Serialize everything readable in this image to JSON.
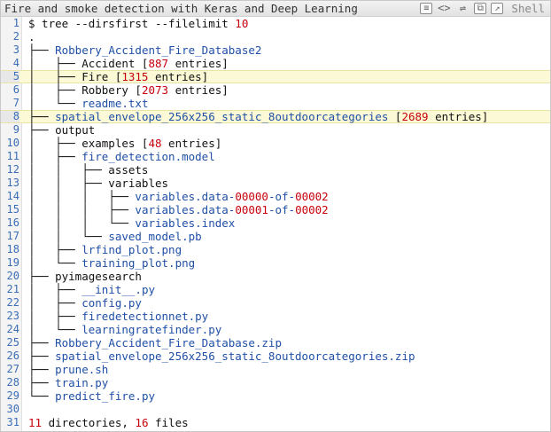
{
  "window": {
    "title": "Fire and smoke detection with Keras and Deep Learning",
    "toolbar": {
      "icons": [
        "code-icon",
        "embed-icon",
        "wrap-icon",
        "copy-icon",
        "popout-icon"
      ],
      "label": "Shell"
    }
  },
  "colors": {
    "default": "#111111",
    "file": "#1f4fa6",
    "num": "#c7000b",
    "highlight": "#fcfad6",
    "line_number": "#3b6db5"
  },
  "lines": [
    {
      "n": "1",
      "hl": false,
      "segs": [
        {
          "t": "$ tree --dirsfirst --filelimit ",
          "c": "default"
        },
        {
          "t": "10",
          "c": "num"
        }
      ]
    },
    {
      "n": "2",
      "hl": false,
      "segs": [
        {
          "t": ".",
          "c": "default"
        }
      ]
    },
    {
      "n": "3",
      "hl": false,
      "segs": [
        {
          "t": "├── ",
          "c": "default"
        },
        {
          "t": "Robbery_Accident_Fire_Database2",
          "c": "file"
        }
      ]
    },
    {
      "n": "4",
      "hl": false,
      "segs": [
        {
          "t": "│   ├── Accident [",
          "c": "default"
        },
        {
          "t": "887",
          "c": "num"
        },
        {
          "t": " entries]",
          "c": "default"
        }
      ]
    },
    {
      "n": "5",
      "hl": true,
      "segs": [
        {
          "t": "│   ├── Fire [",
          "c": "default"
        },
        {
          "t": "1315",
          "c": "num"
        },
        {
          "t": " entries]",
          "c": "default"
        }
      ]
    },
    {
      "n": "6",
      "hl": false,
      "segs": [
        {
          "t": "│   ├── Robbery [",
          "c": "default"
        },
        {
          "t": "2073",
          "c": "num"
        },
        {
          "t": " entries]",
          "c": "default"
        }
      ]
    },
    {
      "n": "7",
      "hl": false,
      "segs": [
        {
          "t": "│   └── ",
          "c": "default"
        },
        {
          "t": "readme.txt",
          "c": "file"
        }
      ]
    },
    {
      "n": "8",
      "hl": true,
      "segs": [
        {
          "t": "├── ",
          "c": "default"
        },
        {
          "t": "spatial_envelope_256x256_static_8outdoorcategories",
          "c": "file"
        },
        {
          "t": " [",
          "c": "default"
        },
        {
          "t": "2689",
          "c": "num"
        },
        {
          "t": " entries]",
          "c": "default"
        }
      ]
    },
    {
      "n": "9",
      "hl": false,
      "segs": [
        {
          "t": "├── output",
          "c": "default"
        }
      ]
    },
    {
      "n": "10",
      "hl": false,
      "segs": [
        {
          "t": "│   ├── examples [",
          "c": "default"
        },
        {
          "t": "48",
          "c": "num"
        },
        {
          "t": " entries]",
          "c": "default"
        }
      ]
    },
    {
      "n": "11",
      "hl": false,
      "segs": [
        {
          "t": "│   ├── ",
          "c": "default"
        },
        {
          "t": "fire_detection.model",
          "c": "file"
        }
      ]
    },
    {
      "n": "12",
      "hl": false,
      "segs": [
        {
          "t": "│   │   ├── assets",
          "c": "default"
        }
      ]
    },
    {
      "n": "13",
      "hl": false,
      "segs": [
        {
          "t": "│   │   ├── variables",
          "c": "default"
        }
      ]
    },
    {
      "n": "14",
      "hl": false,
      "segs": [
        {
          "t": "│   │   │   ├── ",
          "c": "default"
        },
        {
          "t": "variables.data-",
          "c": "file"
        },
        {
          "t": "00000",
          "c": "num"
        },
        {
          "t": "-of-",
          "c": "file"
        },
        {
          "t": "00002",
          "c": "num"
        }
      ]
    },
    {
      "n": "15",
      "hl": false,
      "segs": [
        {
          "t": "│   │   │   ├── ",
          "c": "default"
        },
        {
          "t": "variables.data-",
          "c": "file"
        },
        {
          "t": "00001",
          "c": "num"
        },
        {
          "t": "-of-",
          "c": "file"
        },
        {
          "t": "00002",
          "c": "num"
        }
      ]
    },
    {
      "n": "16",
      "hl": false,
      "segs": [
        {
          "t": "│   │   │   └── ",
          "c": "default"
        },
        {
          "t": "variables.index",
          "c": "file"
        }
      ]
    },
    {
      "n": "17",
      "hl": false,
      "segs": [
        {
          "t": "│   │   └── ",
          "c": "default"
        },
        {
          "t": "saved_model.pb",
          "c": "file"
        }
      ]
    },
    {
      "n": "18",
      "hl": false,
      "segs": [
        {
          "t": "│   ├── ",
          "c": "default"
        },
        {
          "t": "lrfind_plot.png",
          "c": "file"
        }
      ]
    },
    {
      "n": "19",
      "hl": false,
      "segs": [
        {
          "t": "│   └── ",
          "c": "default"
        },
        {
          "t": "training_plot.png",
          "c": "file"
        }
      ]
    },
    {
      "n": "20",
      "hl": false,
      "segs": [
        {
          "t": "├── pyimagesearch",
          "c": "default"
        }
      ]
    },
    {
      "n": "21",
      "hl": false,
      "segs": [
        {
          "t": "│   ├── ",
          "c": "default"
        },
        {
          "t": "__init__.py",
          "c": "file"
        }
      ]
    },
    {
      "n": "22",
      "hl": false,
      "segs": [
        {
          "t": "│   ├── ",
          "c": "default"
        },
        {
          "t": "config.py",
          "c": "file"
        }
      ]
    },
    {
      "n": "23",
      "hl": false,
      "segs": [
        {
          "t": "│   ├── ",
          "c": "default"
        },
        {
          "t": "firedetectionnet.py",
          "c": "file"
        }
      ]
    },
    {
      "n": "24",
      "hl": false,
      "segs": [
        {
          "t": "│   └── ",
          "c": "default"
        },
        {
          "t": "learningratefinder.py",
          "c": "file"
        }
      ]
    },
    {
      "n": "25",
      "hl": false,
      "segs": [
        {
          "t": "├── ",
          "c": "default"
        },
        {
          "t": "Robbery_Accident_Fire_Database.zip",
          "c": "file"
        }
      ]
    },
    {
      "n": "26",
      "hl": false,
      "segs": [
        {
          "t": "├── ",
          "c": "default"
        },
        {
          "t": "spatial_envelope_256x256_static_8outdoorcategories.zip",
          "c": "file"
        }
      ]
    },
    {
      "n": "27",
      "hl": false,
      "segs": [
        {
          "t": "├── ",
          "c": "default"
        },
        {
          "t": "prune.sh",
          "c": "file"
        }
      ]
    },
    {
      "n": "28",
      "hl": false,
      "segs": [
        {
          "t": "├── ",
          "c": "default"
        },
        {
          "t": "train.py",
          "c": "file"
        }
      ]
    },
    {
      "n": "29",
      "hl": false,
      "segs": [
        {
          "t": "└── ",
          "c": "default"
        },
        {
          "t": "predict_fire.py",
          "c": "file"
        }
      ]
    },
    {
      "n": "30",
      "hl": false,
      "segs": []
    },
    {
      "n": "31",
      "hl": false,
      "segs": [
        {
          "t": "11",
          "c": "num"
        },
        {
          "t": " directories, ",
          "c": "default"
        },
        {
          "t": "16",
          "c": "num"
        },
        {
          "t": " files",
          "c": "default"
        }
      ]
    }
  ]
}
